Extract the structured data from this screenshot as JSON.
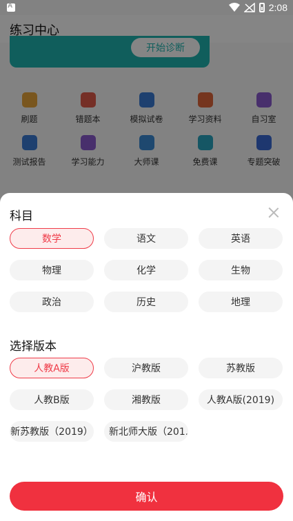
{
  "status_bar": {
    "time": "2:08"
  },
  "background": {
    "title": "练习中心",
    "diagnose_button": "开始诊断",
    "grid": [
      [
        {
          "label": "刷题",
          "icon": "pen-icon",
          "color": "#e8a53a"
        },
        {
          "label": "错题本",
          "icon": "notebook-icon",
          "color": "#e05a4a"
        },
        {
          "label": "模拟试卷",
          "icon": "exam-paper-icon",
          "color": "#3a7bd5"
        },
        {
          "label": "学习资料",
          "icon": "book-icon",
          "color": "#e0663a"
        },
        {
          "label": "自习室",
          "icon": "tv-icon",
          "color": "#8a5ad0"
        }
      ],
      [
        {
          "label": "测试报告",
          "icon": "report-icon",
          "color": "#3a7bd5"
        },
        {
          "label": "学习能力",
          "icon": "bulb-icon",
          "color": "#8a5ad0"
        },
        {
          "label": "大师课",
          "icon": "thumb-icon",
          "color": "#3a8ad5"
        },
        {
          "label": "免费课",
          "icon": "video-icon",
          "color": "#2aa5c0"
        },
        {
          "label": "专题突破",
          "icon": "bookmark-icon",
          "color": "#3a6ad5"
        }
      ]
    ]
  },
  "sheet": {
    "subject_title": "科目",
    "subjects": [
      {
        "label": "数学",
        "selected": true
      },
      {
        "label": "语文",
        "selected": false
      },
      {
        "label": "英语",
        "selected": false
      },
      {
        "label": "物理",
        "selected": false
      },
      {
        "label": "化学",
        "selected": false
      },
      {
        "label": "生物",
        "selected": false
      },
      {
        "label": "政治",
        "selected": false
      },
      {
        "label": "历史",
        "selected": false
      },
      {
        "label": "地理",
        "selected": false
      }
    ],
    "edition_title": "选择版本",
    "editions": [
      {
        "label": "人教A版",
        "selected": true
      },
      {
        "label": "沪教版",
        "selected": false
      },
      {
        "label": "苏教版",
        "selected": false
      },
      {
        "label": "人教B版",
        "selected": false
      },
      {
        "label": "湘教版",
        "selected": false
      },
      {
        "label": "人教A版(2019)",
        "selected": false
      },
      {
        "label": "新苏教版（2019）",
        "selected": false
      },
      {
        "label": "新北师大版（201...",
        "selected": false
      }
    ],
    "confirm_label": "确认"
  },
  "colors": {
    "accent": "#f0313f",
    "teal": "#1fb5b0"
  }
}
